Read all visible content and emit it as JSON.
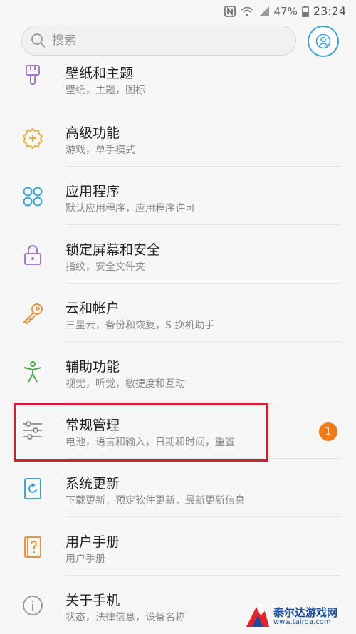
{
  "status_bar": {
    "battery": "47%",
    "time": "23:24"
  },
  "search": {
    "placeholder": "搜索"
  },
  "colors": {
    "accent": "#3aa5d8",
    "badge": "#f07a17",
    "highlight": "#d3202a"
  },
  "items": [
    {
      "title": "壁纸和主题",
      "subtitle": "壁纸，主题，图标",
      "icon": "paintbrush-icon",
      "icon_color": "#a779c9"
    },
    {
      "title": "高级功能",
      "subtitle": "游戏，单手模式",
      "icon": "gear-plus-icon",
      "icon_color": "#e8b23a"
    },
    {
      "title": "应用程序",
      "subtitle": "默认应用程序，应用程序许可",
      "icon": "apps-grid-icon",
      "icon_color": "#3aa5d8"
    },
    {
      "title": "锁定屏幕和安全",
      "subtitle": "指纹，安全文件夹",
      "icon": "lock-icon",
      "icon_color": "#a779c9"
    },
    {
      "title": "云和帐户",
      "subtitle": "三星云，备份和恢复，S 换机助手",
      "icon": "key-icon",
      "icon_color": "#e8963a"
    },
    {
      "title": "辅助功能",
      "subtitle": "视觉，听觉，敏捷度和互动",
      "icon": "accessibility-icon",
      "icon_color": "#4caf50"
    },
    {
      "title": "常规管理",
      "subtitle": "电池，语言和输入，日期和时间，重置",
      "icon": "sliders-icon",
      "icon_color": "#888888",
      "badge": "1"
    },
    {
      "title": "系统更新",
      "subtitle": "下载更新，预定软件更新，最新更新信息",
      "icon": "update-icon",
      "icon_color": "#3aa5d8"
    },
    {
      "title": "用户手册",
      "subtitle": "用户手册",
      "icon": "manual-icon",
      "icon_color": "#e8963a"
    },
    {
      "title": "关于手机",
      "subtitle": "状态，法律信息，设备名称",
      "icon": "info-icon",
      "icon_color": "#999999"
    }
  ],
  "watermark": {
    "name": "泰尔达游戏网",
    "url": "www.tairda.com"
  }
}
